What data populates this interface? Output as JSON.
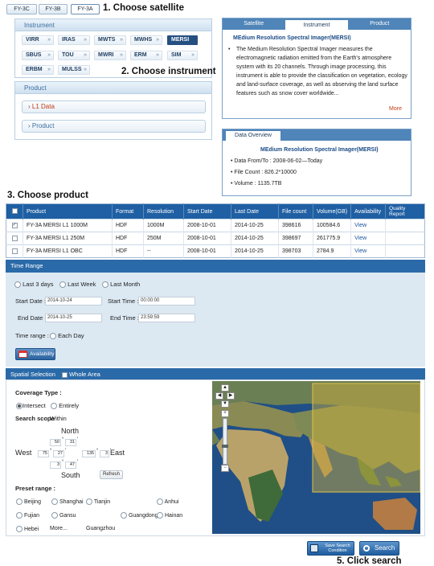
{
  "top_tabs": [
    "FY-3C",
    "FY-3B",
    "FY-3A"
  ],
  "steps": {
    "s1": "1. Choose satellite",
    "s2": "2. Choose instrument",
    "s3": "3. Choose product",
    "s5": "5. Click search"
  },
  "instrument": {
    "title": "Instrument",
    "items": [
      "VIRR",
      "IRAS",
      "MWTS",
      "MWHS",
      "MERSI",
      "SBUS",
      "TOU",
      "MWRI",
      "ERM",
      "SIM",
      "ERBM",
      "MULSS"
    ],
    "selected": "MERSI"
  },
  "product": {
    "title": "Product",
    "items": [
      "L1 Data",
      "Product"
    ]
  },
  "info_panel": {
    "tabs": [
      "Satellite",
      "Instrument",
      "Product"
    ],
    "title": "MEdium Resolution Spectral Imager(MERSI)",
    "description": "The Medium Resolution Spectral Imager measures the electromagnetic radiation emitted from the Earth's atmosphere system with its 20 channels. Through image processing, this instrument is able to provide the classification on vegetation, ecology and land-surface coverage, as well as observing the land surface features such as snow cover worldwide...",
    "more": "More"
  },
  "overview": {
    "tab": "Data Overview",
    "title": "MEdium Resolution Spectral Imager(MERSI)",
    "date": "Data From/To : 2008-06-02—Today",
    "count": "File Count : 826.2*10000",
    "volume": "Volume : 1135.7TB"
  },
  "table": {
    "headers": [
      "",
      "Product",
      "Format",
      "Resolution",
      "Start Date",
      "Last Date",
      "File count",
      "Volume(GB)",
      "Availability",
      "Quality Report"
    ],
    "rows": [
      {
        "checked": "✓",
        "product": "FY-3A MERSI L1 1000M",
        "format": "HDF",
        "resolution": "1000M",
        "start": "2008-10-01",
        "last": "2014-10-25",
        "count": "398616",
        "volume": "100584.6",
        "availability": "View",
        "quality": ""
      },
      {
        "checked": "",
        "product": "FY-3A MERSI L1 250M",
        "format": "HDF",
        "resolution": "250M",
        "start": "2008-10-01",
        "last": "2014-10-25",
        "count": "398697",
        "volume": "261775.9",
        "availability": "View",
        "quality": ""
      },
      {
        "checked": "",
        "product": "FY-3A MERSI L1 OBC",
        "format": "HDF",
        "resolution": "--",
        "start": "2008-10-01",
        "last": "2014-10-25",
        "count": "398703",
        "volume": "2784.9",
        "availability": "View",
        "quality": ""
      }
    ]
  },
  "time_range": {
    "title": "Time Range",
    "quick": [
      "Last 3 days",
      "Last Week",
      "Last Month"
    ],
    "start_date_label": "Start Date :",
    "start_date": "2014-10-24",
    "start_time_label": "Start Time :",
    "start_time": "00:00:00",
    "end_date_label": "End Date :",
    "end_date": "2014-10-25",
    "end_time_label": "End Time :",
    "end_time": "23:59:59",
    "time_range_label": "Time range :",
    "each_day": "Each Day",
    "availability_btn": "Availability"
  },
  "spatial": {
    "title": "Spatial Selection",
    "whole_area": "Whole Area",
    "coverage_label": "Coverage Type :",
    "intersect": "Intersect",
    "entirely": "Entirely",
    "scope_label": "Search scope",
    "within": "Within",
    "north": "North",
    "south": "South",
    "west": "West",
    "east": "East",
    "n_deg": "50",
    "n_min": "31",
    "w_deg": "75",
    "w_min": "27",
    "e_deg": "135",
    "e_min": "3",
    "s_deg": "3",
    "s_min": "47",
    "refresh": "Refresh",
    "preset_label": "Preset range :",
    "cities": [
      "Beijing",
      "Shanghai",
      "Tianjin",
      "Anhui",
      "Fujian",
      "Gansu",
      "Guangdong",
      "Hainan",
      "Hebei",
      "More...",
      "Guangzhou"
    ]
  },
  "buttons": {
    "save": "Save Search Condition",
    "search": "Search"
  }
}
